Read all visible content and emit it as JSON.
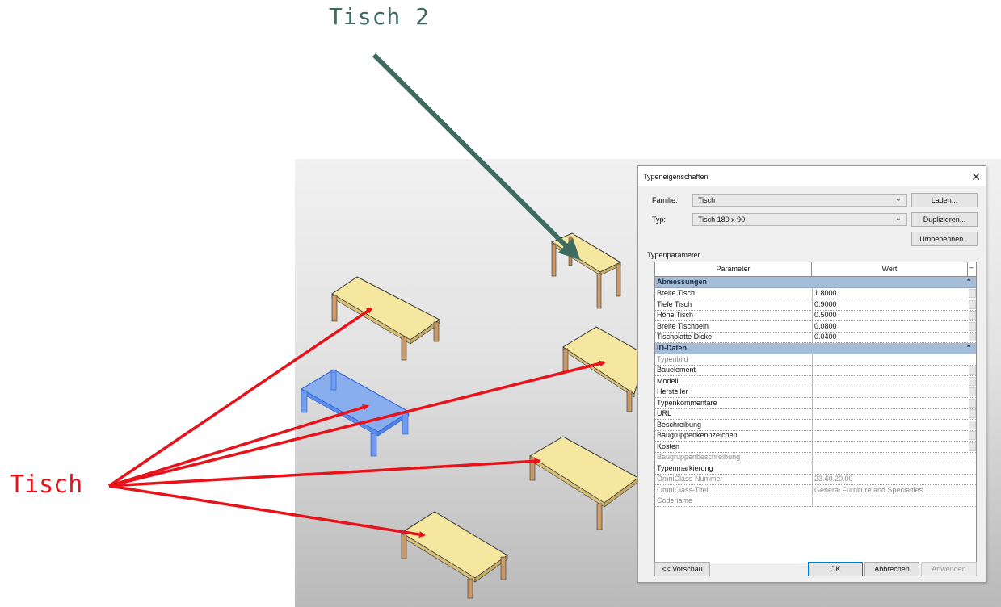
{
  "annotations": {
    "tisch2": "Tisch 2",
    "tisch": "Tisch"
  },
  "colors": {
    "accent_green": "#3d6b5f",
    "accent_red": "#e8121b",
    "table_top": "#f6e7a0",
    "table_leg": "#c99a68",
    "selected_table": "#7aa6f0",
    "group_header": "#a7bcd6"
  },
  "dialog": {
    "title": "Typeneigenschaften",
    "close_icon": "close-icon",
    "familie_label": "Familie:",
    "familie_value": "Tisch",
    "typ_label": "Typ:",
    "typ_value": "Tisch 180 x 90",
    "btn_laden": "Laden...",
    "btn_duplizieren": "Duplizieren...",
    "btn_umbenennen": "Umbenennen...",
    "typenparameter_label": "Typenparameter",
    "col_parameter": "Parameter",
    "col_wert": "Wert",
    "groups": [
      {
        "name": "Abmessungen",
        "rows": [
          {
            "param": "Breite Tisch",
            "value": "1.8000",
            "editable": true
          },
          {
            "param": "Tiefe Tisch",
            "value": "0.9000",
            "editable": true
          },
          {
            "param": "Höhe Tisch",
            "value": "0.5000",
            "editable": true
          },
          {
            "param": "Breite Tischbein",
            "value": "0.0800",
            "editable": true
          },
          {
            "param": "Tischplatte Dicke",
            "value": "0.0400",
            "editable": true
          }
        ]
      },
      {
        "name": "ID-Daten",
        "rows": [
          {
            "param": "Typenbild",
            "value": "",
            "dim": true
          },
          {
            "param": "Bauelement",
            "value": "",
            "editable": true
          },
          {
            "param": "Modell",
            "value": "",
            "editable": true
          },
          {
            "param": "Hersteller",
            "value": "",
            "editable": true
          },
          {
            "param": "Typenkommentare",
            "value": "",
            "editable": true
          },
          {
            "param": "URL",
            "value": "",
            "editable": true
          },
          {
            "param": "Beschreibung",
            "value": "",
            "editable": true
          },
          {
            "param": "Baugruppenkennzeichen",
            "value": "",
            "editable": true
          },
          {
            "param": "Kosten",
            "value": "",
            "editable": true
          },
          {
            "param": "Baugruppenbeschreibung",
            "value": "",
            "dim": true
          },
          {
            "param": "Typenmarkierung",
            "value": ""
          },
          {
            "param": "OmniClass-Nummer",
            "value": "23.40.20.00",
            "dim": true
          },
          {
            "param": "OmniClass-Titel",
            "value": "General Furniture and Specialties",
            "dim": true
          },
          {
            "param": "Codename",
            "value": "",
            "dim": true
          }
        ]
      }
    ],
    "btn_vorschau": "<< Vorschau",
    "btn_ok": "OK",
    "btn_abbrechen": "Abbrechen",
    "btn_anwenden": "Anwenden"
  }
}
